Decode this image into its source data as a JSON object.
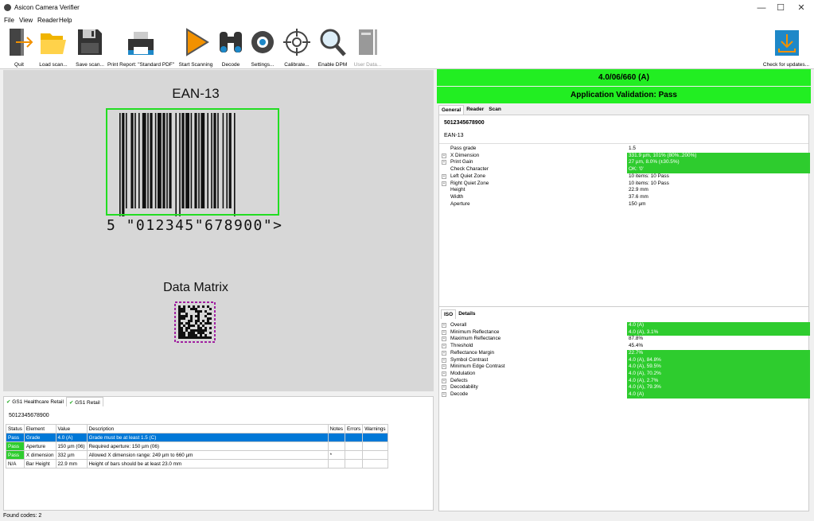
{
  "window": {
    "title": "Asicon Camera Verifier",
    "minimize": "—",
    "maximize": "☐",
    "close": "✕"
  },
  "menu": [
    "File",
    "View",
    "Reader",
    "Help"
  ],
  "toolbar": {
    "quit": "Quit",
    "load": "Load scan...",
    "save": "Save scan...",
    "print": "Print Report: \"Standard PDF\"",
    "start": "Start Scanning",
    "decode": "Decode",
    "settings": "Settings...",
    "calibrate": "Calibrate...",
    "enable_dpm": "Enable DPM",
    "user_data": "User Data...",
    "check_updates": "Check for updates..."
  },
  "image": {
    "label_ean": "EAN-13",
    "barcode_text": "5 \"012345\"678900\">",
    "label_dm": "Data Matrix"
  },
  "bottom": {
    "tabs": [
      "GS1 Healthcare Retail",
      "GS1 Retail"
    ],
    "code": "5012345678900",
    "columns": [
      "Status",
      "Element",
      "Value",
      "Description",
      "Notes",
      "Errors",
      "Warnings"
    ],
    "rows": [
      {
        "status": "Pass",
        "element": "Grade",
        "value": "4.0 (A)",
        "description": "Grade must be at least 1.5 (C)",
        "notes": "",
        "errors": "",
        "warnings": "",
        "selected": true
      },
      {
        "status": "Pass",
        "element": "Aperture",
        "value": "150 µm (06)",
        "description": "Required aperture: 150 µm (06)",
        "notes": "",
        "errors": "",
        "warnings": ""
      },
      {
        "status": "Pass",
        "element": "X dimension",
        "value": "332 µm",
        "description": "Allowed X dimension range: 249 µm to 660 µm",
        "notes": "*",
        "errors": "",
        "warnings": ""
      },
      {
        "status": "N/A",
        "element": "Bar Height",
        "value": "22.9 mm",
        "description": "Height of bars should be at least 23.0 mm",
        "notes": "",
        "errors": "",
        "warnings": ""
      }
    ]
  },
  "right": {
    "grade": "4.0/06/660 (A)",
    "validation": "Application Validation: Pass",
    "tabs": [
      "General",
      "Reader",
      "Scan"
    ],
    "code": "5012345678900",
    "symbology": "EAN-13",
    "general_rows": [
      {
        "name": "Pass grade",
        "value": "1.5",
        "green": false,
        "exp": false
      },
      {
        "name": "X Dimension",
        "value": "331.9 µm, 101% (80%..200%)",
        "green": true,
        "exp": true
      },
      {
        "name": "Print Gain",
        "value": "27 µm, 8.0% (±30.5%)",
        "green": true,
        "exp": true
      },
      {
        "name": "Check Character",
        "value": "OK: '0'",
        "green": true,
        "exp": false
      },
      {
        "name": "Left Quiet Zone",
        "value": "10 items: 10 Pass",
        "green": false,
        "exp": true
      },
      {
        "name": "Right Quiet Zone",
        "value": "10 items: 10 Pass",
        "green": false,
        "exp": true
      },
      {
        "name": "Height",
        "value": "22.9 mm",
        "green": false,
        "exp": false
      },
      {
        "name": "Width",
        "value": "37.6 mm",
        "green": false,
        "exp": false
      },
      {
        "name": "Aperture",
        "value": "150 µm",
        "green": false,
        "exp": false
      }
    ],
    "iso_tabs": [
      "ISO",
      "Details"
    ],
    "iso_rows": [
      {
        "name": "Overall",
        "value": "4.0 (A)",
        "green": true
      },
      {
        "name": "Minimum Reflectance",
        "value": "4.0 (A), 3.1%",
        "green": true
      },
      {
        "name": "Maximum Reflectance",
        "value": "87.8%",
        "green": false
      },
      {
        "name": "Threshold",
        "value": "45.4%",
        "green": false
      },
      {
        "name": "Reflectance Margin",
        "value": "22.7%",
        "green": true
      },
      {
        "name": "Symbol Contrast",
        "value": "4.0 (A), 84.8%",
        "green": true
      },
      {
        "name": "Minimum Edge Contrast",
        "value": "4.0 (A), 59.5%",
        "green": true
      },
      {
        "name": "Modulation",
        "value": "4.0 (A), 70.2%",
        "green": true
      },
      {
        "name": "Defects",
        "value": "4.0 (A), 2.7%",
        "green": true
      },
      {
        "name": "Decodability",
        "value": "4.0 (A), 79.3%",
        "green": true
      },
      {
        "name": "Decode",
        "value": "4.0 (A)",
        "green": true
      }
    ]
  },
  "status": "Found codes: 2"
}
